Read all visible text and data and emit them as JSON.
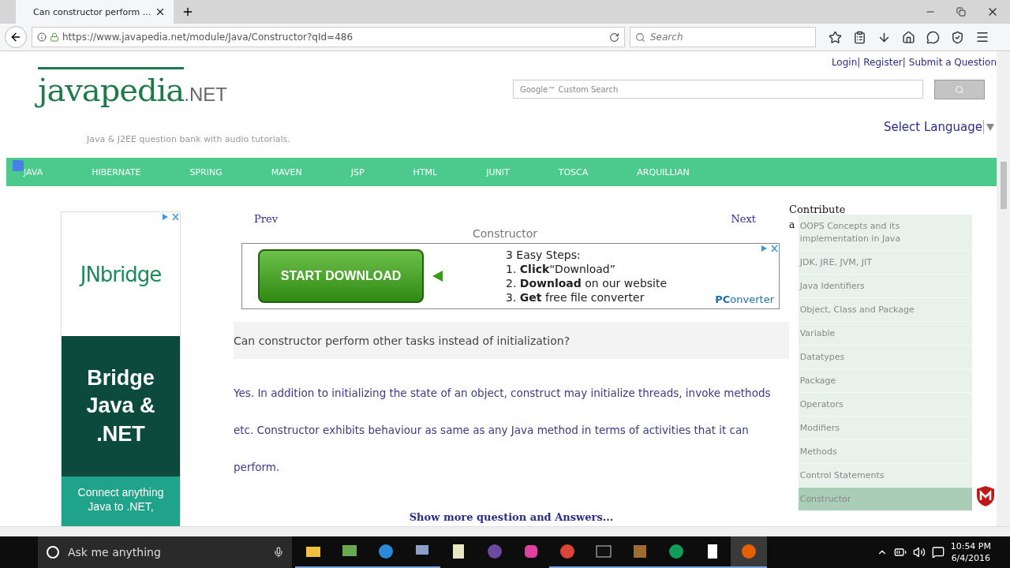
{
  "browser": {
    "tab": {
      "title": "Can constructor perform ...",
      "selected": true
    },
    "url": "https://www.javapedia.net/module/Java/Constructor?qId=486",
    "search": {
      "placeholder": "Search"
    }
  },
  "header": {
    "links": [
      "Login|",
      "Register|",
      "Submit a Question"
    ],
    "logo": {
      "name": "javapedia",
      "suffix": ".NET"
    },
    "tagline": "Java & J2EE question bank with audio tutorials.",
    "search": {
      "placeholder": "Google™ Custom Search"
    },
    "language": "Select Language"
  },
  "nav": [
    {
      "label": "JAVA"
    },
    {
      "label": "HIBERNATE"
    },
    {
      "label": "SPRING"
    },
    {
      "label": "MAVEN"
    },
    {
      "label": "JSP"
    },
    {
      "label": "HTML"
    },
    {
      "label": "JUNIT"
    },
    {
      "label": "TOSCA"
    },
    {
      "label": "ARQUILLIAN"
    }
  ],
  "side_ad": {
    "brand": "JNbridge",
    "headline": "Bridge Java & .NET",
    "body": "Connect anything Java to .NET,"
  },
  "article": {
    "prev": "Prev",
    "title": "Constructor",
    "next": "Next",
    "banner": {
      "button": "START DOWNLOAD",
      "heading": "3 Easy Steps:",
      "steps": [
        "1. **Click**“Download”",
        "2. **Download** on our website",
        "3. **Get** free file converter"
      ],
      "brand_bold": "PC",
      "brand_rest": "onverter"
    },
    "question": "Can constructor perform other tasks instead of initialization?",
    "answer": "Yes. In addition to initializing the state of an object, construct may initialize threads, invoke methods etc. Constructor exhibits behaviour as same as any Java method in terms of activities that it can perform.",
    "more": "Show more question and Answers..."
  },
  "sidebar": {
    "heading": "Contribute",
    "note": "a",
    "items": [
      {
        "label": "OOPS Concepts and its implementation in Java",
        "selected": false
      },
      {
        "label": "JDK, JRE, JVM, JIT",
        "selected": false
      },
      {
        "label": "Java Identifiers",
        "selected": false
      },
      {
        "label": "Object, Class and Package",
        "selected": false
      },
      {
        "label": "Variable",
        "selected": false
      },
      {
        "label": "Datatypes",
        "selected": false
      },
      {
        "label": "Package",
        "selected": false
      },
      {
        "label": "Operators",
        "selected": false
      },
      {
        "label": "Modifiers",
        "selected": false
      },
      {
        "label": "Methods",
        "selected": false
      },
      {
        "label": "Control Statements",
        "selected": false
      },
      {
        "label": "Constructor",
        "selected": true
      }
    ]
  },
  "taskbar": {
    "search": {
      "placeholder": "Ask me anything"
    },
    "time": "10:54 PM",
    "date": "6/4/2016"
  }
}
